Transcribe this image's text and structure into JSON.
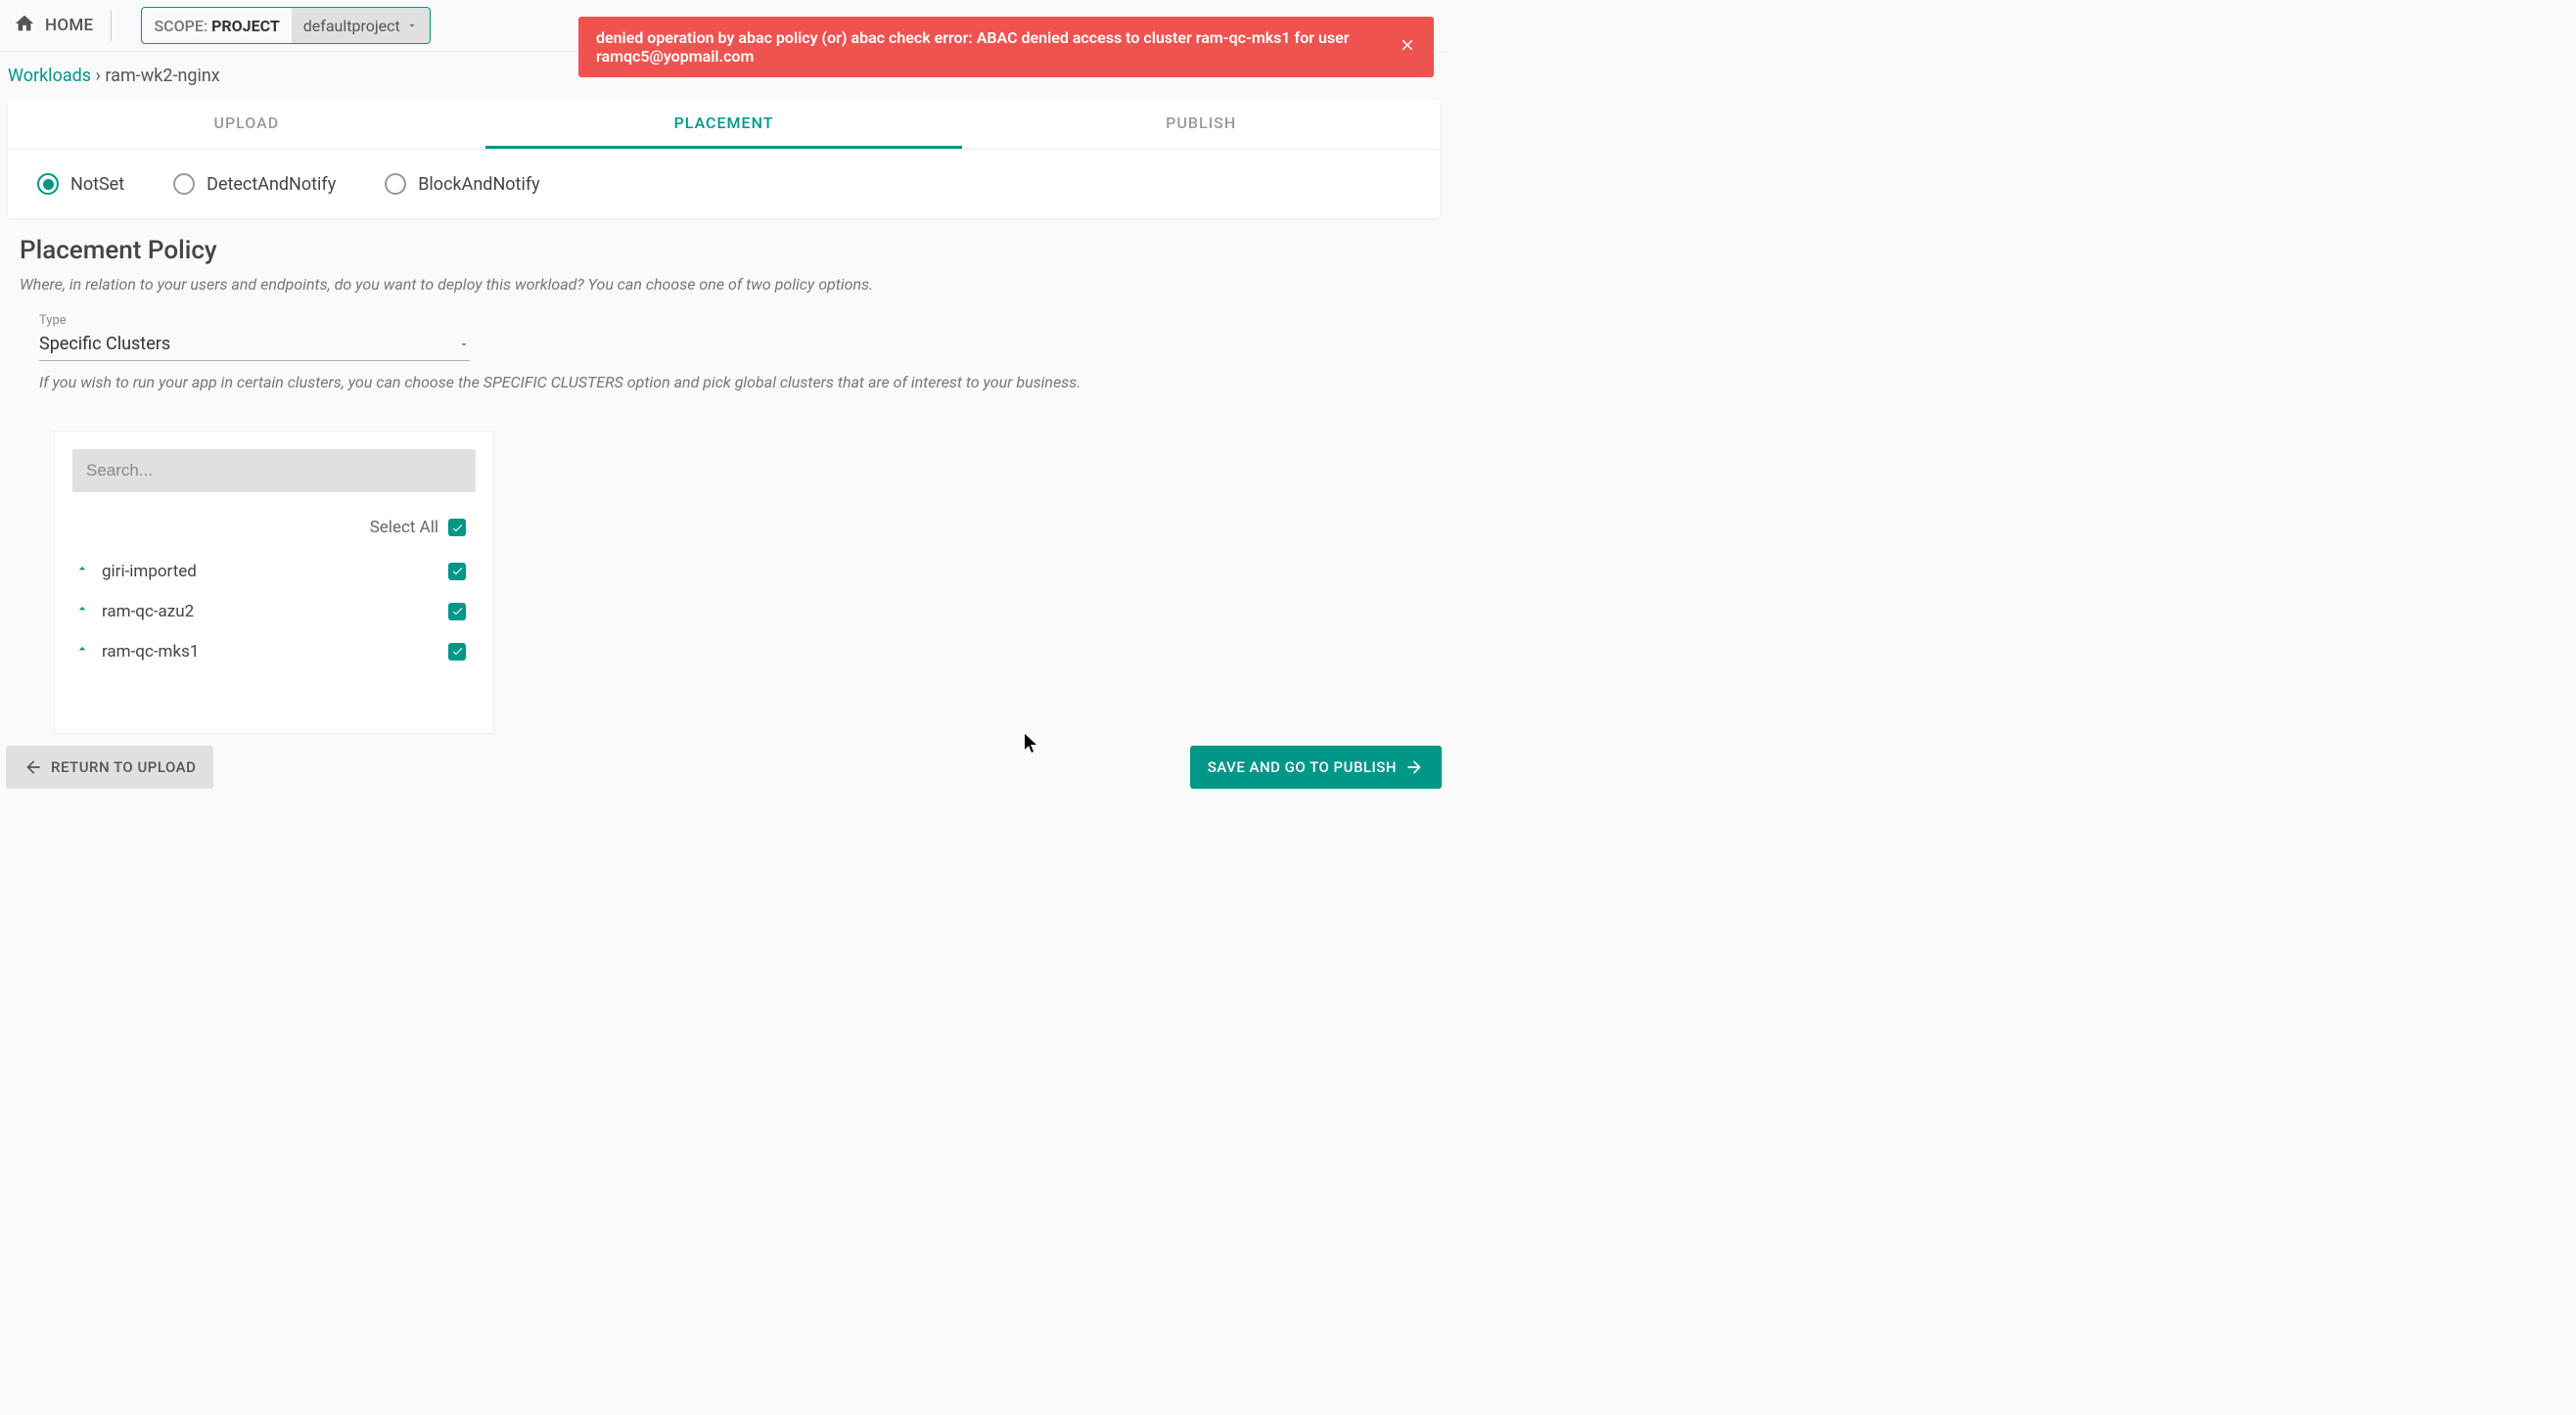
{
  "topBar": {
    "homeLabel": "HOME",
    "scopePrefix": "SCOPE: ",
    "scopeValue": "PROJECT",
    "projectName": "defaultproject",
    "userEmail": "ramqc5@yopmail.com"
  },
  "alert": {
    "message": "denied operation by abac policy (or) abac check error: ABAC denied access to cluster ram-qc-mks1 for user ramqc5@yopmail.com"
  },
  "breadcrumb": {
    "parent": "Workloads",
    "separator": " › ",
    "current": "ram-wk2-nginx"
  },
  "wizard": {
    "tabs": [
      "UPLOAD",
      "PLACEMENT",
      "PUBLISH"
    ],
    "activeIndex": 1
  },
  "radios": {
    "options": [
      "NotSet",
      "DetectAndNotify",
      "BlockAndNotify"
    ],
    "selectedIndex": 0
  },
  "placement": {
    "title": "Placement Policy",
    "subtitle": "Where, in relation to your users and endpoints, do you want to deploy this workload? You can choose one of two policy options.",
    "typeLabel": "Type",
    "typeValue": "Specific Clusters",
    "typeHelp": "If you wish to run your app in certain clusters, you can choose the SPECIFIC CLUSTERS option and pick global clusters that are of interest to your business."
  },
  "clusterList": {
    "searchPlaceholder": "Search...",
    "selectAllLabel": "Select All",
    "selectAllChecked": true,
    "items": [
      {
        "name": "giri-imported",
        "checked": true
      },
      {
        "name": "ram-qc-azu2",
        "checked": true
      },
      {
        "name": "ram-qc-mks1",
        "checked": true
      }
    ]
  },
  "buttons": {
    "back": "RETURN TO UPLOAD",
    "next": "SAVE AND GO TO PUBLISH"
  }
}
